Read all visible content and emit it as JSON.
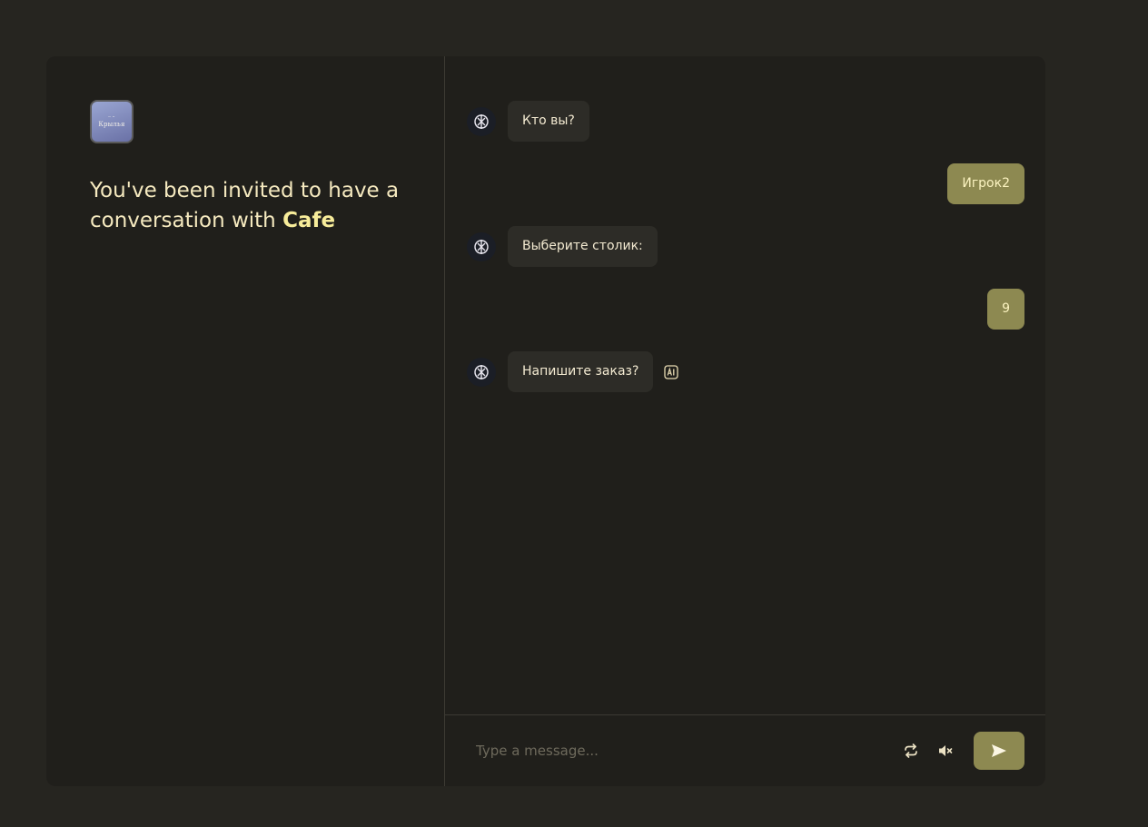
{
  "left": {
    "logo_text": "Крылья",
    "invite_text": "You've been invited to have a conversation with ",
    "bot_name": "Cafe"
  },
  "chat": {
    "messages": [
      {
        "role": "bot",
        "text": "Кто вы?"
      },
      {
        "role": "user",
        "text": "Игрок2"
      },
      {
        "role": "bot",
        "text": "Выберите столик:"
      },
      {
        "role": "user",
        "text": "9"
      },
      {
        "role": "bot",
        "text": "Напишите заказ?",
        "ai_badge": "ai-icon"
      }
    ]
  },
  "composer": {
    "placeholder": "Type a message...",
    "icons": [
      "refresh-icon",
      "mute-icon",
      "send-icon"
    ]
  },
  "colors": {
    "page_bg": "#262520",
    "card_bg": "#201f1b",
    "accent": "#8d8951",
    "text_light": "#f5e9bf"
  }
}
